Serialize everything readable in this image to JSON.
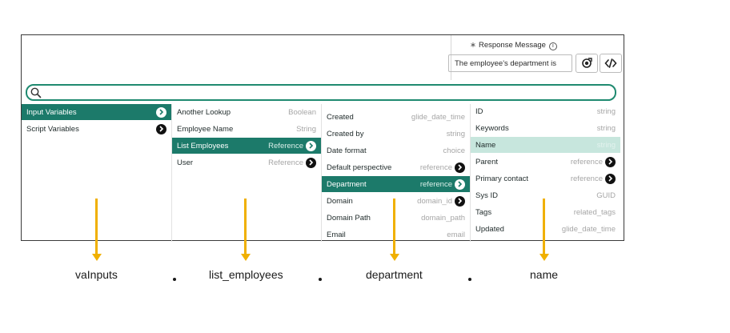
{
  "response": {
    "label": "Response Message",
    "required_mark": "∗",
    "info_mark": "i",
    "value": "The employee's department is"
  },
  "search": {
    "value": ""
  },
  "columns": {
    "col1": [
      {
        "label": "Input Variables",
        "type": "",
        "arrow": true,
        "state": "selected"
      },
      {
        "label": "Script Variables",
        "type": "",
        "arrow": true,
        "state": ""
      }
    ],
    "col2": [
      {
        "label": "Another Lookup",
        "type": "Boolean",
        "arrow": false,
        "state": ""
      },
      {
        "label": "Employee Name",
        "type": "String",
        "arrow": false,
        "state": ""
      },
      {
        "label": "List Employees",
        "type": "Reference",
        "arrow": true,
        "state": "selected"
      },
      {
        "label": "User",
        "type": "Reference",
        "arrow": true,
        "state": ""
      }
    ],
    "col3": [
      {
        "label": "Created",
        "type": "glide_date_time",
        "arrow": false,
        "state": ""
      },
      {
        "label": "Created by",
        "type": "string",
        "arrow": false,
        "state": ""
      },
      {
        "label": "Date format",
        "type": "choice",
        "arrow": false,
        "state": ""
      },
      {
        "label": "Default perspective",
        "type": "reference",
        "arrow": true,
        "state": ""
      },
      {
        "label": "Department",
        "type": "reference",
        "arrow": true,
        "state": "selected"
      },
      {
        "label": "Domain",
        "type": "domain_id",
        "arrow": true,
        "state": ""
      },
      {
        "label": "Domain Path",
        "type": "domain_path",
        "arrow": false,
        "state": ""
      },
      {
        "label": "Email",
        "type": "email",
        "arrow": false,
        "state": ""
      }
    ],
    "col4": [
      {
        "label": "ID",
        "type": "string",
        "arrow": false,
        "state": ""
      },
      {
        "label": "Keywords",
        "type": "string",
        "arrow": false,
        "state": ""
      },
      {
        "label": "Name",
        "type": "string",
        "arrow": false,
        "state": "highlighted"
      },
      {
        "label": "Parent",
        "type": "reference",
        "arrow": true,
        "state": ""
      },
      {
        "label": "Primary contact",
        "type": "reference",
        "arrow": true,
        "state": ""
      },
      {
        "label": "Sys ID",
        "type": "GUID",
        "arrow": false,
        "state": ""
      },
      {
        "label": "Tags",
        "type": "related_tags",
        "arrow": false,
        "state": ""
      },
      {
        "label": "Updated",
        "type": "glide_date_time",
        "arrow": false,
        "state": ""
      }
    ]
  },
  "path_labels": [
    "vaInputs",
    "list_employees",
    "department",
    "name"
  ],
  "colors": {
    "accent": "#1c7a6a",
    "highlight": "#c7e6dd",
    "pointer": "#f0b000"
  }
}
